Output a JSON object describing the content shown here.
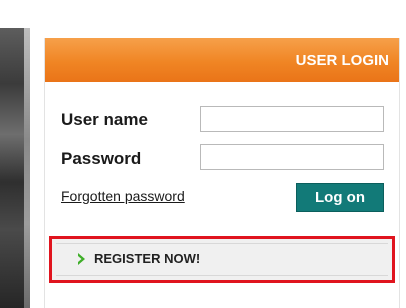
{
  "login": {
    "header_title": "USER LOGIN",
    "username_label": "User name",
    "username_value": "",
    "password_label": "Password",
    "password_value": "",
    "forgot_link": "Forgotten password",
    "logon_button": "Log on",
    "register_label": "REGISTER NOW!"
  },
  "colors": {
    "header_orange": "#f08524",
    "logon_teal": "#127a78",
    "highlight_red": "#e0141e",
    "register_arrow_green": "#3fae29"
  },
  "icons": {
    "register": "chevron-right-icon"
  }
}
